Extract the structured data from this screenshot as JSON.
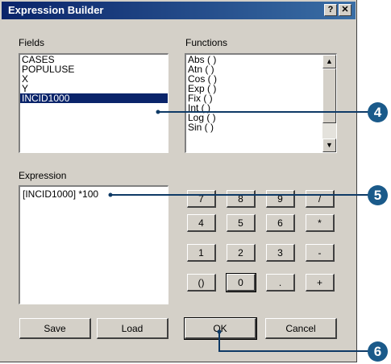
{
  "window": {
    "title": "Expression Builder",
    "help_button": "?",
    "close_button": "✕"
  },
  "fields": {
    "label": "Fields",
    "items": [
      "CASES",
      "POPULUSE",
      "X",
      "Y",
      "INCID1000"
    ],
    "selected": "INCID1000"
  },
  "functions": {
    "label": "Functions",
    "items": [
      "Abs ( )",
      "Atn ( )",
      "Cos ( )",
      "Exp ( )",
      "Fix ( )",
      "Int ( )",
      "Log ( )",
      "Sin ( )"
    ]
  },
  "expression": {
    "label": "Expression",
    "value": "[INCID1000] *100"
  },
  "keypad": {
    "rows": [
      [
        "7",
        "8",
        "9",
        "/"
      ],
      [
        "4",
        "5",
        "6",
        "*"
      ],
      [
        "1",
        "2",
        "3",
        "-"
      ],
      [
        "()",
        "0",
        ".",
        "+"
      ]
    ]
  },
  "buttons": {
    "save": "Save",
    "load": "Load",
    "ok": "OK",
    "cancel": "Cancel"
  },
  "callouts": [
    "4",
    "5",
    "6"
  ],
  "colors": {
    "dialog_bg": "#d4d0c8",
    "title_bar": "#0a246a",
    "selection": "#0a246a",
    "callout": "#1a5a8a"
  }
}
